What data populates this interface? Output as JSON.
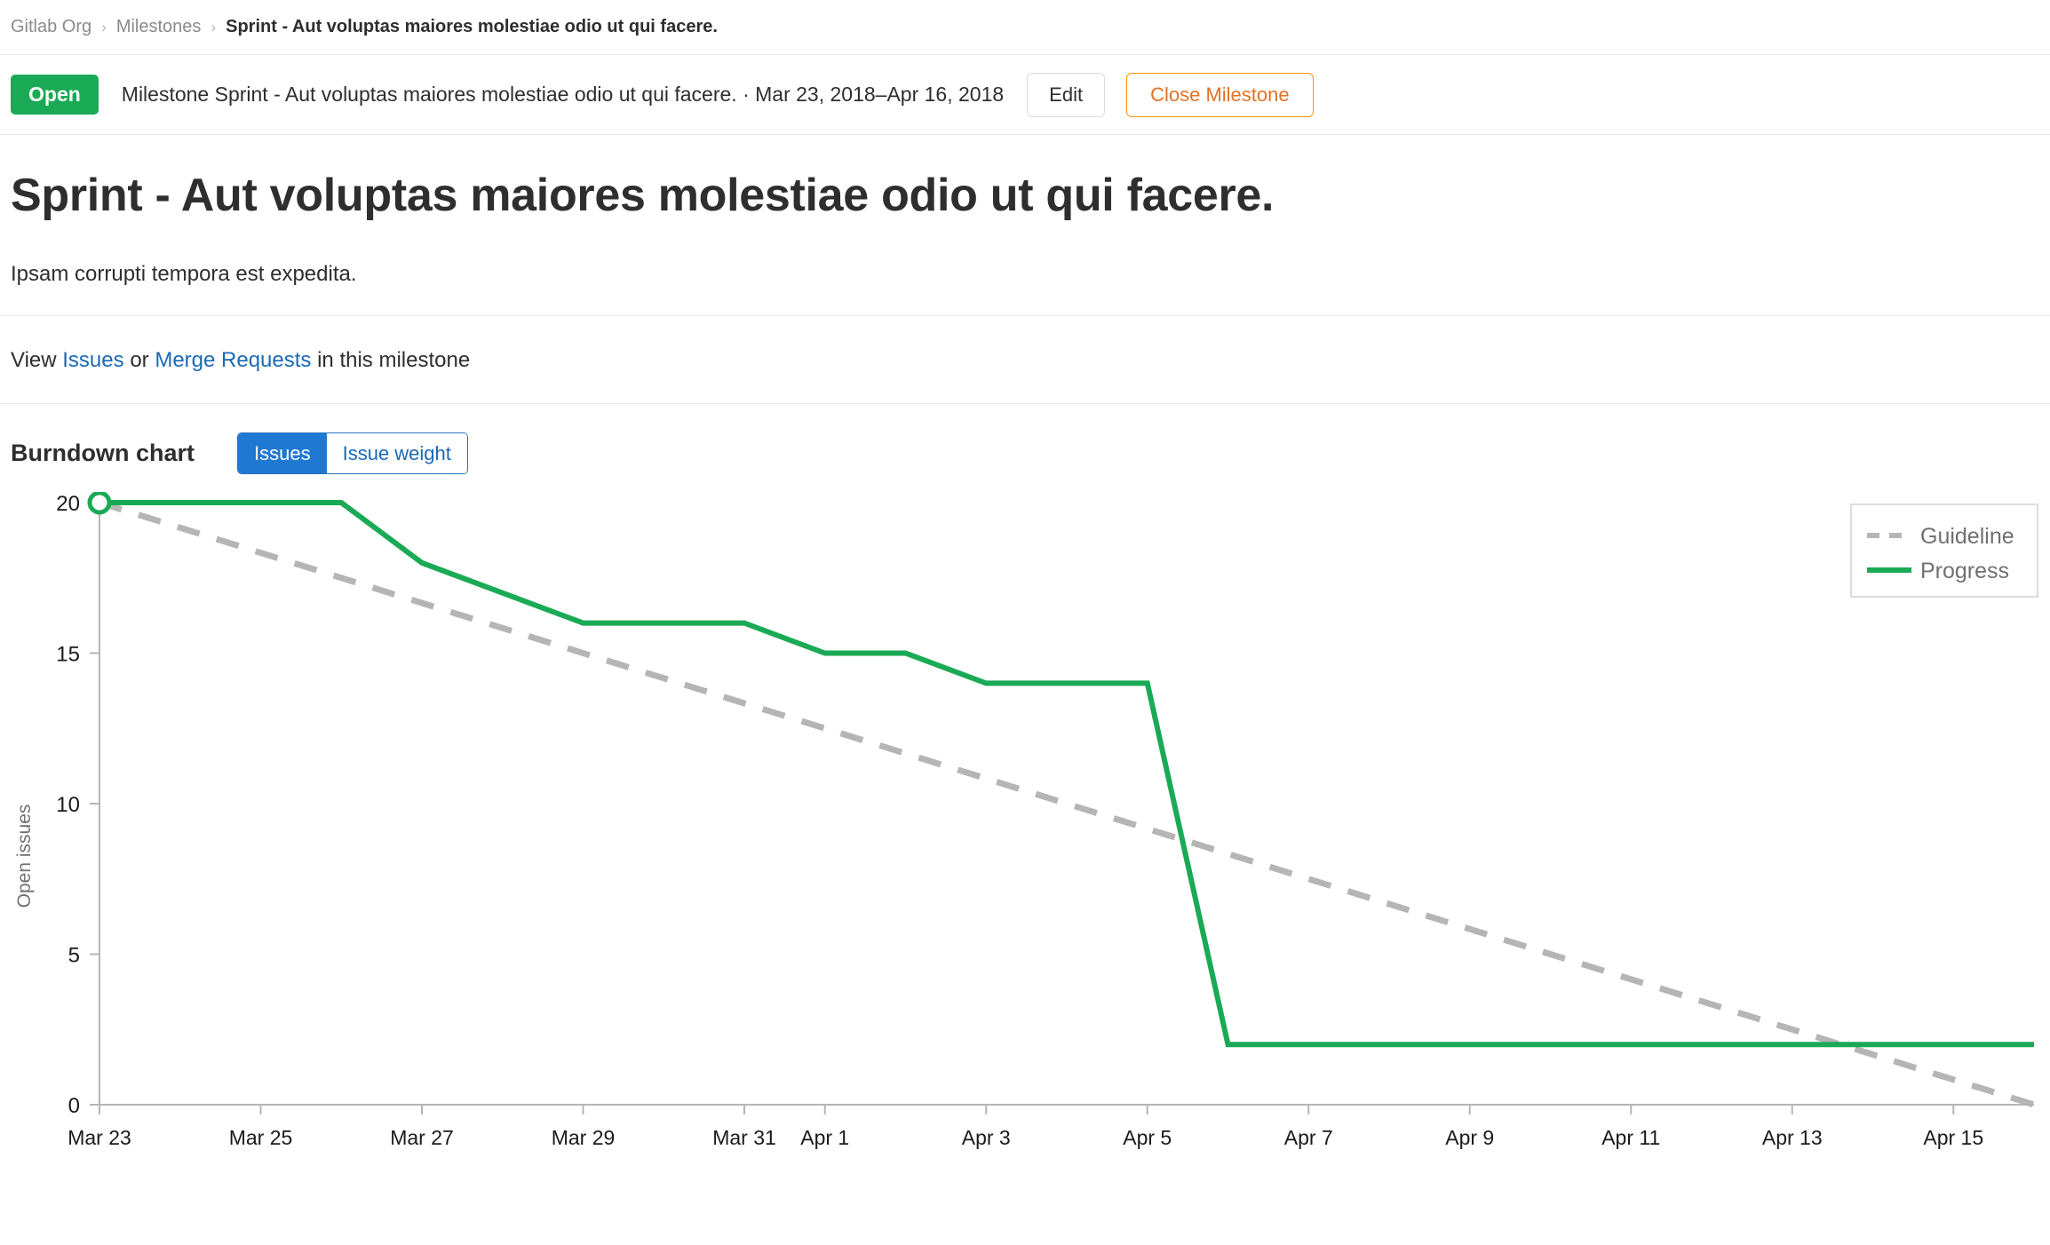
{
  "breadcrumb": {
    "org": "Gitlab Org",
    "section": "Milestones",
    "current": "Sprint - Aut voluptas maiores molestiae odio ut qui facere.",
    "separator": "›"
  },
  "status": {
    "badge": "Open",
    "text": "Milestone Sprint - Aut voluptas maiores molestiae odio ut qui facere. · Mar 23, 2018–Apr 16, 2018",
    "edit_label": "Edit",
    "close_label": "Close Milestone",
    "badge_color": "#1aaa55",
    "close_color": "#e17223"
  },
  "milestone": {
    "title": "Sprint - Aut voluptas maiores molestiae odio ut qui facere.",
    "description": "Ipsam corrupti tempora est expedita."
  },
  "view_links": {
    "prefix": "View",
    "issues": "Issues",
    "conjunction": "or",
    "merge_requests": "Merge Requests",
    "suffix": "in this milestone"
  },
  "burndown": {
    "heading": "Burndown chart",
    "toggle_issues": "Issues",
    "toggle_weight": "Issue weight",
    "active_toggle": "Issues"
  },
  "chart_data": {
    "type": "line",
    "title": "Burndown chart",
    "xlabel": "",
    "ylabel": "Open issues",
    "ylim": [
      0,
      20
    ],
    "yticks": [
      0,
      5,
      10,
      15,
      20
    ],
    "xticks": [
      "Mar 23",
      "Mar 25",
      "Mar 27",
      "Mar 29",
      "Mar 31",
      "Apr 1",
      "Apr 3",
      "Apr 5",
      "Apr 7",
      "Apr 9",
      "Apr 11",
      "Apr 13",
      "Apr 15"
    ],
    "xtick_days": [
      0,
      2,
      4,
      6,
      8,
      9,
      11,
      13,
      15,
      17,
      19,
      21,
      23
    ],
    "x_domain_days": [
      0,
      24
    ],
    "grid": false,
    "legend_position": "top-right",
    "colors": {
      "guideline": "#b5b5b5",
      "progress": "#1aaa55"
    },
    "series": [
      {
        "name": "Guideline",
        "style": "dashed",
        "color": "#b5b5b5",
        "points": [
          {
            "day": 0,
            "label": "Mar 23",
            "value": 20
          },
          {
            "day": 24,
            "label": "Apr 16",
            "value": 0
          }
        ]
      },
      {
        "name": "Progress",
        "style": "solid",
        "color": "#1aaa55",
        "marker_first": true,
        "points": [
          {
            "day": 0,
            "label": "Mar 23",
            "value": 20
          },
          {
            "day": 1,
            "label": "Mar 24",
            "value": 20
          },
          {
            "day": 2,
            "label": "Mar 25",
            "value": 20
          },
          {
            "day": 3,
            "label": "Mar 26",
            "value": 20
          },
          {
            "day": 4,
            "label": "Mar 27",
            "value": 18
          },
          {
            "day": 5,
            "label": "Mar 28",
            "value": 17
          },
          {
            "day": 6,
            "label": "Mar 29",
            "value": 16
          },
          {
            "day": 7,
            "label": "Mar 30",
            "value": 16
          },
          {
            "day": 8,
            "label": "Mar 31",
            "value": 16
          },
          {
            "day": 9,
            "label": "Apr 1",
            "value": 15
          },
          {
            "day": 10,
            "label": "Apr 2",
            "value": 15
          },
          {
            "day": 11,
            "label": "Apr 3",
            "value": 14
          },
          {
            "day": 12,
            "label": "Apr 4",
            "value": 14
          },
          {
            "day": 13,
            "label": "Apr 5",
            "value": 14
          },
          {
            "day": 14,
            "label": "Apr 6",
            "value": 2
          },
          {
            "day": 15,
            "label": "Apr 7",
            "value": 2
          },
          {
            "day": 16,
            "label": "Apr 8",
            "value": 2
          },
          {
            "day": 17,
            "label": "Apr 9",
            "value": 2
          },
          {
            "day": 18,
            "label": "Apr 10",
            "value": 2
          },
          {
            "day": 19,
            "label": "Apr 11",
            "value": 2
          },
          {
            "day": 20,
            "label": "Apr 12",
            "value": 2
          },
          {
            "day": 21,
            "label": "Apr 13",
            "value": 2
          },
          {
            "day": 22,
            "label": "Apr 14",
            "value": 2
          },
          {
            "day": 23,
            "label": "Apr 15",
            "value": 2
          },
          {
            "day": 24,
            "label": "Apr 16",
            "value": 2
          }
        ]
      }
    ],
    "legend": [
      "Guideline",
      "Progress"
    ]
  }
}
